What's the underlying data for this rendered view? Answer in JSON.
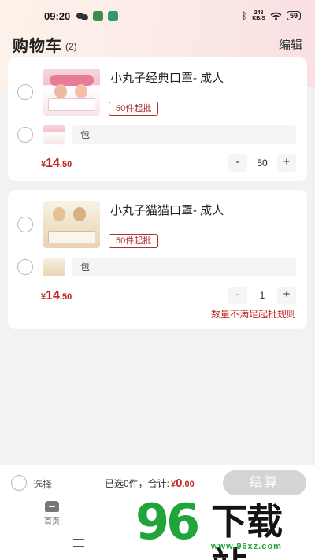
{
  "status_bar": {
    "time": "09:20",
    "speed_value": "248",
    "speed_unit": "KB/S",
    "battery": "59"
  },
  "header": {
    "title": "购物车",
    "count": "(2)",
    "edit_label": "编辑"
  },
  "items": [
    {
      "name": "小丸子经典口罩- 成人",
      "moq_tag": "50件起批",
      "sku_label": "包",
      "price_symbol": "¥",
      "price_int": "14",
      "price_dec": ".50",
      "quantity": "50",
      "minus": "-",
      "plus": "+",
      "warning": ""
    },
    {
      "name": "小丸子猫猫口罩- 成人",
      "moq_tag": "50件起批",
      "sku_label": "包",
      "price_symbol": "¥",
      "price_int": "14",
      "price_dec": ".50",
      "quantity": "1",
      "minus": "-",
      "plus": "+",
      "warning": "数量不满足起批规则"
    }
  ],
  "checkout": {
    "select_all_label": "选择",
    "selected_text": "已选0件，合计:",
    "total_symbol": "¥",
    "total_int": "0",
    "total_dec": ".00",
    "button_label": "结算"
  },
  "tab_bar": {
    "home_label": "首页"
  },
  "watermark": {
    "number": "96",
    "text": "下载站",
    "url": "www.96xz.com"
  },
  "colors": {
    "price_red": "#c0271f",
    "checkout_disabled": "#d4d4d4",
    "watermark_green": "#1fa539"
  }
}
